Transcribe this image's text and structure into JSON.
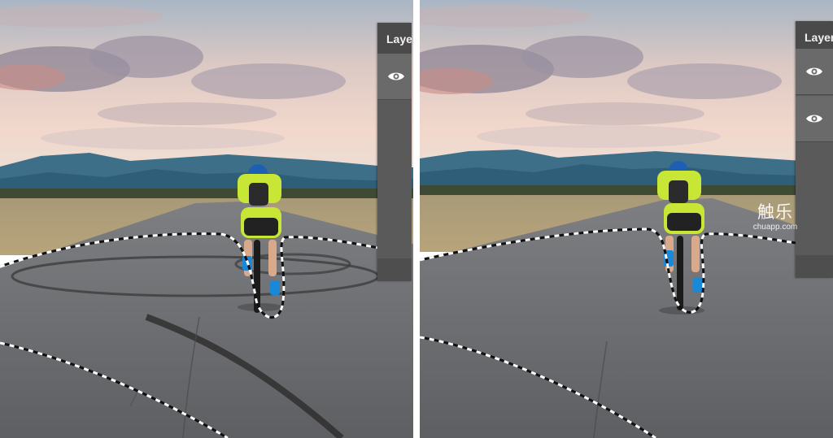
{
  "layers_panel": {
    "title": "Layers",
    "left_eye_icon": "eye-icon",
    "right_eye_icons": [
      "eye-icon",
      "eye-icon"
    ]
  },
  "watermark": {
    "logo": "触乐",
    "url": "chuapp.com"
  },
  "colors": {
    "panel_bg": "#5a5a5a",
    "panel_header": "#4a4a4a",
    "row_bg": "#6a6a6a",
    "jersey": "#c8e635",
    "helmet": "#1e5fb4"
  }
}
